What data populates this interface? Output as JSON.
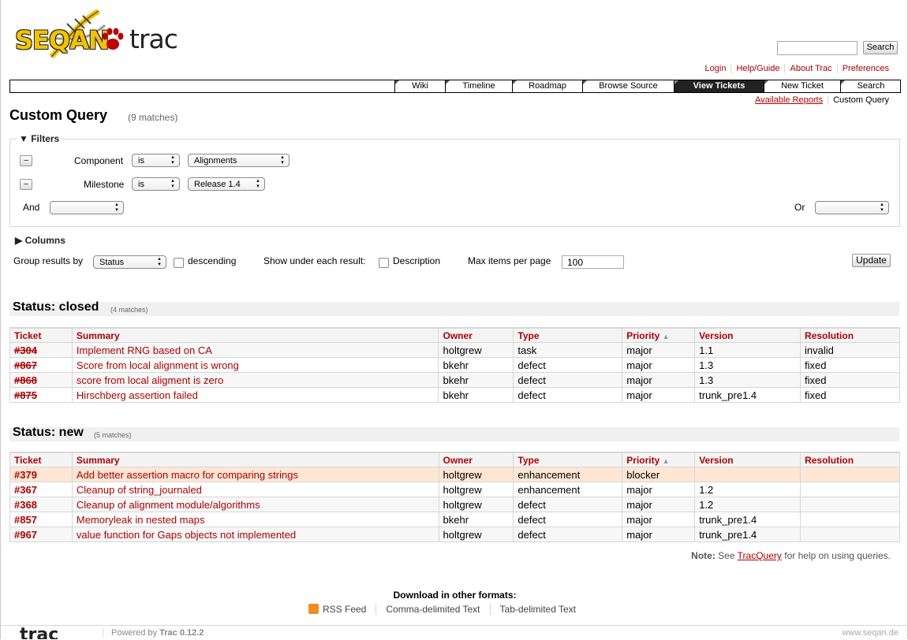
{
  "search": {
    "placeholder": "",
    "button": "Search"
  },
  "metanav": [
    "Login",
    "Help/Guide",
    "About Trac",
    "Preferences"
  ],
  "mainnav": [
    "Wiki",
    "Timeline",
    "Roadmap",
    "Browse Source",
    "View Tickets",
    "New Ticket",
    "Search"
  ],
  "ctxtnav": [
    "Available Reports",
    "Custom Query"
  ],
  "page": {
    "title": "Custom Query",
    "matches": "(9 matches)"
  },
  "filters": {
    "legend": "Filters",
    "rows": [
      {
        "field": "Component",
        "op": "is",
        "value": "Alignments"
      },
      {
        "field": "Milestone",
        "op": "is",
        "value": "Release 1.4"
      }
    ],
    "and_label": "And",
    "or_label": "Or",
    "remove": "–"
  },
  "columns_label": "Columns",
  "options": {
    "group_label": "Group results by",
    "group_value": "Status",
    "descending": "descending",
    "show_label": "Show under each result:",
    "description": "Description",
    "max_label": "Max items per page",
    "max_value": "100",
    "update": "Update"
  },
  "headers": [
    "Ticket",
    "Summary",
    "Owner",
    "Type",
    "Priority",
    "Version",
    "Resolution"
  ],
  "groups": [
    {
      "title": "Status: closed",
      "count": "(4 matches)",
      "rows": [
        {
          "id": "#304",
          "summary": "Implement RNG based on CA",
          "owner": "holtgrew",
          "type": "task",
          "priority": "major",
          "version": "1.1",
          "resolution": "invalid"
        },
        {
          "id": "#867",
          "summary": "Score from local alignment is wrong",
          "owner": "bkehr",
          "type": "defect",
          "priority": "major",
          "version": "1.3",
          "resolution": "fixed"
        },
        {
          "id": "#868",
          "summary": "score from local aligment is zero",
          "owner": "bkehr",
          "type": "defect",
          "priority": "major",
          "version": "1.3",
          "resolution": "fixed"
        },
        {
          "id": "#875",
          "summary": "Hirschberg assertion failed",
          "owner": "bkehr",
          "type": "defect",
          "priority": "major",
          "version": "trunk_pre1.4",
          "resolution": "fixed"
        }
      ]
    },
    {
      "title": "Status: new",
      "count": "(5 matches)",
      "rows": [
        {
          "id": "#379",
          "summary": "Add better assertion macro for comparing strings",
          "owner": "holtgrew",
          "type": "enhancement",
          "priority": "blocker",
          "version": "",
          "resolution": ""
        },
        {
          "id": "#367",
          "summary": "Cleanup of string_journaled",
          "owner": "holtgrew",
          "type": "enhancement",
          "priority": "major",
          "version": "1.2",
          "resolution": ""
        },
        {
          "id": "#368",
          "summary": "Cleanup of alignment module/algorithms",
          "owner": "holtgrew",
          "type": "defect",
          "priority": "major",
          "version": "1.2",
          "resolution": ""
        },
        {
          "id": "#857",
          "summary": "Memoryleak in nested maps",
          "owner": "bkehr",
          "type": "defect",
          "priority": "major",
          "version": "trunk_pre1.4",
          "resolution": ""
        },
        {
          "id": "#967",
          "summary": "value function for Gaps objects not implemented",
          "owner": "holtgrew",
          "type": "defect",
          "priority": "major",
          "version": "trunk_pre1.4",
          "resolution": ""
        }
      ]
    }
  ],
  "note": {
    "bold": "Note:",
    "pre": "See",
    "link": "TracQuery",
    "post": "for help on using queries."
  },
  "downloads": {
    "title": "Download in other formats:",
    "formats": [
      "RSS Feed",
      "Comma-delimited Text",
      "Tab-delimited Text"
    ]
  },
  "footer": {
    "logo": "trac",
    "powered_pre": "Powered by",
    "powered_name": "Trac 0.12.2",
    "site": "www.seqan.de"
  },
  "logo": {
    "seqan": "SEQAN",
    "trac": "trac"
  },
  "colors": {
    "link": "#b00000",
    "active_tab": "#222222",
    "blocker_row": "#fde6d3"
  }
}
